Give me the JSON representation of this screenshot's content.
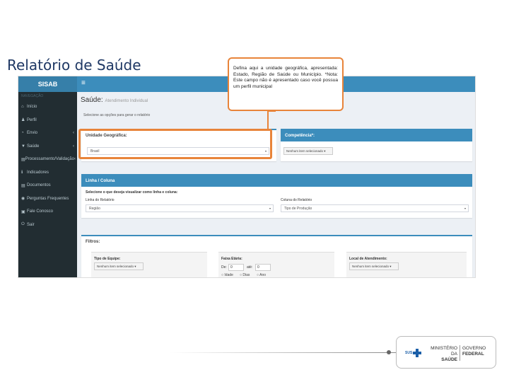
{
  "slide": {
    "title": "Relatório de Saúde"
  },
  "app": {
    "brand": "SISAB",
    "sidebar_header": "NAVEGAÇÃO",
    "sidebar": [
      {
        "icon": "home-icon",
        "glyph": "⌂",
        "label": "Início",
        "caret": ""
      },
      {
        "icon": "user-icon",
        "glyph": "♟",
        "label": "Perfil",
        "caret": ""
      },
      {
        "icon": "send-icon",
        "glyph": "◔",
        "label": "Envio",
        "caret": "‹"
      },
      {
        "icon": "health-icon",
        "glyph": "▼",
        "label": "Saúde",
        "caret": "‹"
      },
      {
        "icon": "processing-icon",
        "glyph": "▤",
        "label": "Processamento/Validação",
        "caret": "‹"
      },
      {
        "icon": "info-icon",
        "glyph": "ℹ",
        "label": "Indicadores",
        "caret": ""
      },
      {
        "icon": "documents-icon",
        "glyph": "▤",
        "label": "Documentos",
        "caret": ""
      },
      {
        "icon": "faq-icon",
        "glyph": "◉",
        "label": "Perguntas Frequentes",
        "caret": ""
      },
      {
        "icon": "contact-icon",
        "glyph": "▣",
        "label": "Fale Conosco",
        "caret": ""
      },
      {
        "icon": "exit-icon",
        "glyph": "⏻",
        "label": "Sair",
        "caret": ""
      }
    ],
    "menu_glyph": "≡",
    "page_title": "Saúde:",
    "page_subtitle": "Atendimento Individual",
    "hint": "Selecione as opções para gerar o relatório"
  },
  "unidade": {
    "title": "Unidade Geográfica:",
    "value": "Brasil",
    "arrow": "▾"
  },
  "competencia": {
    "title": "Competência*:",
    "value": "Nenhum item selecionado ▾"
  },
  "linha_coluna": {
    "title": "Linha / Coluna",
    "hint": "Selecione o que deseja visualizar como linha e coluna:",
    "linha_label": "Linha do Relatório",
    "linha_value": "Região",
    "coluna_label": "Coluna do Relatório",
    "coluna_value": "Tipo de Produção",
    "arrow": "▾"
  },
  "filtros": {
    "title": "Filtros:",
    "tipo_equipe_label": "Tipo de Equipe:",
    "tipo_equipe_value": "Nenhum item selecionado ▾",
    "faixa_label": "Faixa Etária:",
    "de_label": "De:",
    "de_value": "0",
    "ate_label": "até:",
    "ate_value": "0",
    "radio_idade": "○ Idade",
    "radio_dias": "○ Dias",
    "radio_ano": "○ Ano",
    "local_label": "Local de Atendimento:",
    "local_value": "Nenhum item selecionado ▾"
  },
  "callout": {
    "text": "Defina aqui a unidade geográfica, apresentada: Estado, Região de Saúde ou Município. *Nota: Este campo não é apresentado caso você possua um perfil municipal"
  },
  "footer_logo": {
    "sus": "SUS",
    "ministerio_1": "MINISTÉRIO DA",
    "ministerio_2": "SAÚDE",
    "governo_1": "GOVERNO",
    "governo_2": "FEDERAL",
    "accent": "#1b5fa8"
  },
  "colors": {
    "highlight": "#e8843a",
    "primary": "#3c8dbc",
    "sidebar": "#222d32"
  }
}
